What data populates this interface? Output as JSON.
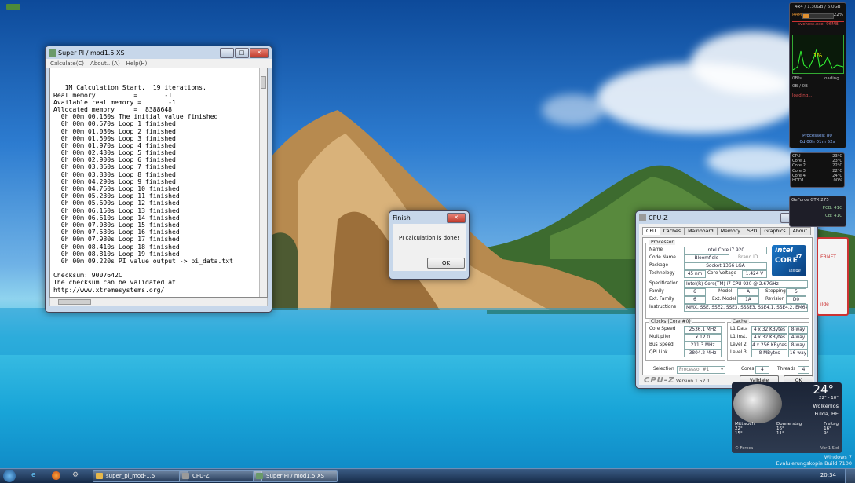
{
  "top_icons": [
    {
      "color": "#b5883a"
    },
    {
      "color": "#c49a4a"
    },
    {
      "color": "#b23c2f"
    },
    {
      "color": "#4d8a3a"
    }
  ],
  "superpi": {
    "title": "Super PI / mod1.5 XS",
    "menu": [
      "Calculate(C)",
      "About...(A)",
      "Help(H)"
    ],
    "lines": [
      "   1M Calculation Start.  19 iterations.",
      "Real memory          =       -1",
      "Available real memory =       -1",
      "Allocated memory     =  8388648",
      "  0h 00m 00.160s The initial value finished",
      "  0h 00m 00.570s Loop 1 finished",
      "  0h 00m 01.030s Loop 2 finished",
      "  0h 00m 01.500s Loop 3 finished",
      "  0h 00m 01.970s Loop 4 finished",
      "  0h 00m 02.430s Loop 5 finished",
      "  0h 00m 02.900s Loop 6 finished",
      "  0h 00m 03.360s Loop 7 finished",
      "  0h 00m 03.830s Loop 8 finished",
      "  0h 00m 04.290s Loop 9 finished",
      "  0h 00m 04.760s Loop 10 finished",
      "  0h 00m 05.230s Loop 11 finished",
      "  0h 00m 05.690s Loop 12 finished",
      "  0h 00m 06.150s Loop 13 finished",
      "  0h 00m 06.610s Loop 14 finished",
      "  0h 00m 07.080s Loop 15 finished",
      "  0h 00m 07.530s Loop 16 finished",
      "  0h 00m 07.980s Loop 17 finished",
      "  0h 00m 08.410s Loop 18 finished",
      "  0h 00m 08.810s Loop 19 finished",
      "  0h 00m 09.220s PI value output -> pi_data.txt",
      "",
      "Checksum: 9007642C",
      "The checksum can be validated at",
      "http://www.xtremesystems.org/"
    ]
  },
  "finish_dialog": {
    "title": "Finish",
    "message": "PI calculation is done!",
    "ok": "OK"
  },
  "cpuz": {
    "title": "CPU-Z",
    "tabs": [
      "CPU",
      "Caches",
      "Mainboard",
      "Memory",
      "SPD",
      "Graphics",
      "About"
    ],
    "processor_group": "Processor",
    "name_label": "Name",
    "name": "Intel Core i7 920",
    "codename_label": "Code Name",
    "codename": "Bloomfield",
    "brandid_label": "Brand ID",
    "package_label": "Package",
    "package": "Socket 1366 LGA",
    "technology_label": "Technology",
    "technology": "45 nm",
    "corevoltage_label": "Core Voltage",
    "corevoltage": "1.424 V",
    "spec_label": "Specification",
    "spec": "Intel(R) Core(TM) i7 CPU     920  @ 2.67GHz",
    "family_label": "Family",
    "family": "6",
    "model_label": "Model",
    "model": "A",
    "stepping_label": "Stepping",
    "stepping": "5",
    "extfamily_label": "Ext. Family",
    "extfamily": "6",
    "extmodel_label": "Ext. Model",
    "extmodel": "1A",
    "revision_label": "Revision",
    "revision": "D0",
    "instructions_label": "Instructions",
    "instructions": "MMX, SSE, SSE2, SSE3, SSSE3, SSE4.1, SSE4.2, EM64T",
    "clocks_group": "Clocks (Core #0)",
    "corespeed_label": "Core Speed",
    "corespeed": "2536.1 MHz",
    "multiplier_label": "Multiplier",
    "multiplier": "x 12.0",
    "busspeed_label": "Bus Speed",
    "busspeed": "211.3 MHz",
    "qpi_label": "QPI Link",
    "qpi": "3804.2 MHz",
    "cache_group": "Cache",
    "l1d_label": "L1 Data",
    "l1d": "4 x 32 KBytes",
    "l1d_way": "8-way",
    "l1i_label": "L1 Inst.",
    "l1i": "4 x 32 KBytes",
    "l1i_way": "4-way",
    "l2_label": "Level 2",
    "l2": "4 x 256 KBytes",
    "l2_way": "8-way",
    "l3_label": "Level 3",
    "l3": "8 MBytes",
    "l3_way": "16-way",
    "selection_label": "Selection",
    "selection": "Processor #1",
    "cores_label": "Cores",
    "cores": "4",
    "threads_label": "Threads",
    "threads": "4",
    "logo": "CPU-Z",
    "version": "Version 1.52.1",
    "validate": "Validate",
    "ok": "OK",
    "intel_badge": {
      "brand": "intel",
      "core": "CORE",
      "suffix": "i7",
      "inside": "inside"
    }
  },
  "gadgets": {
    "meter_top": "4x4 / 1.30GB / 6.0GB",
    "ram_label": "RAM",
    "ram_pct": "22%",
    "proc_label": "svchost.exe: 96MB",
    "cpu_pct": "1%",
    "net_left": "0B/s",
    "net_right": "loading...",
    "disk_left": "0B / 0B",
    "loading": "loading...",
    "processes": "Processes: 80",
    "uptime": "0d 00h 01m 52s",
    "temps": [
      {
        "label": "CPU",
        "value": "23°C"
      },
      {
        "label": "Core 1",
        "value": "23°C"
      },
      {
        "label": "Core 2",
        "value": "22°C"
      },
      {
        "label": "Core 3",
        "value": "22°C"
      },
      {
        "label": "Core 4",
        "value": "24°C"
      },
      {
        "label": "HDD1",
        "value": "00%"
      }
    ],
    "gpu_name": "GeForce GTX 275",
    "gpu_temp": "PCB: 41C",
    "gpu_temp2": "CB: 41C",
    "side_text": "ERNET",
    "side_text2": "ilde",
    "weather_temp": "24°",
    "weather_range": "22° - 10°",
    "weather_cond": "Wolkenlos",
    "weather_city": "Fulda, HE",
    "weather_days": [
      {
        "day": "Mittwoch",
        "hi": "22°",
        "lo": "15°"
      },
      {
        "day": "Donnerstag",
        "hi": "16°",
        "lo": "11°"
      },
      {
        "day": "Freitag",
        "hi": "16°",
        "lo": "9°"
      }
    ],
    "weather_source": "© Foreca",
    "weather_updated": "Vor 1 Std"
  },
  "watermark": {
    "line1": "Windows 7",
    "line2": "Evaluierungskopie Build 7100"
  },
  "taskbar": {
    "items": [
      {
        "label": "super_pi_mod-1.5",
        "active": false,
        "icon_color": "#e7b84a"
      },
      {
        "label": "CPU-Z",
        "active": false,
        "icon_color": "#9a9a9a"
      },
      {
        "label": "Super PI / mod1.5 XS",
        "active": true,
        "icon_color": "#6a9a6a"
      }
    ],
    "clock": "20:34"
  },
  "colors": {
    "accent": "#2a5f9e",
    "intel_blue": "#0a6cbc"
  }
}
